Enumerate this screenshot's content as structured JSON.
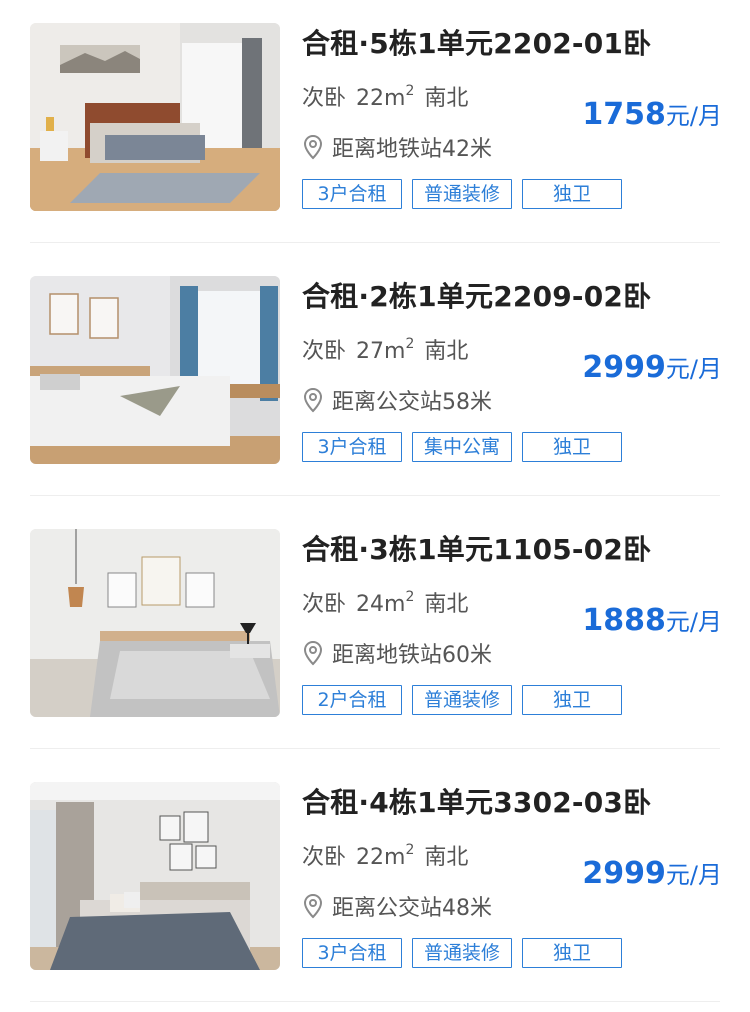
{
  "listings": [
    {
      "title": "合租·5栋1单元2202-01卧",
      "room_type": "次卧",
      "area": "22m",
      "area_sup": "2",
      "orientation": "南北",
      "location": "距离地铁站42米",
      "price": "1758",
      "price_unit": "元/月",
      "tags": [
        "3户合租",
        "普通装修",
        "独卫"
      ]
    },
    {
      "title": "合租·2栋1单元2209-02卧",
      "room_type": "次卧",
      "area": "27m",
      "area_sup": "2",
      "orientation": "南北",
      "location": "距离公交站58米",
      "price": "2999",
      "price_unit": "元/月",
      "tags": [
        "3户合租",
        "集中公寓",
        "独卫"
      ]
    },
    {
      "title": "合租·3栋1单元1105-02卧",
      "room_type": "次卧",
      "area": "24m",
      "area_sup": "2",
      "orientation": "南北",
      "location": "距离地铁站60米",
      "price": "1888",
      "price_unit": "元/月",
      "tags": [
        "2户合租",
        "普通装修",
        "独卫"
      ]
    },
    {
      "title": "合租·4栋1单元3302-03卧",
      "room_type": "次卧",
      "area": "22m",
      "area_sup": "2",
      "orientation": "南北",
      "location": "距离公交站48米",
      "price": "2999",
      "price_unit": "元/月",
      "tags": [
        "3户合租",
        "普通装修",
        "独卫"
      ]
    }
  ],
  "icons": {
    "location": "location-pin-icon"
  },
  "colors": {
    "price": "#1a6bd8",
    "tag_border": "#2d7fd8",
    "divider": "#eeeeee"
  }
}
